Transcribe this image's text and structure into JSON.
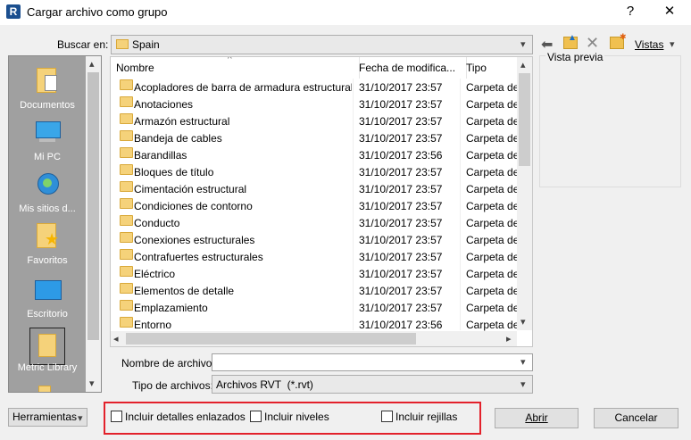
{
  "window": {
    "title": "Cargar archivo como grupo",
    "help_label": "?",
    "close_label": "✕",
    "app_icon_letter": "R"
  },
  "lookin": {
    "label": "Buscar en:",
    "value": "Spain"
  },
  "toolbar": {
    "views_label": "Vistas"
  },
  "places": [
    {
      "label": "Documentos"
    },
    {
      "label": "Mi PC"
    },
    {
      "label": "Mis sitios d..."
    },
    {
      "label": "Favoritos"
    },
    {
      "label": "Escritorio"
    },
    {
      "label": "Metric Library"
    }
  ],
  "columns": {
    "name": "Nombre",
    "date": "Fecha de modifica...",
    "type": "Tipo"
  },
  "files": [
    {
      "name": "Acopladores de barra de armadura estructural",
      "date": "31/10/2017 23:57",
      "type": "Carpeta de"
    },
    {
      "name": "Anotaciones",
      "date": "31/10/2017 23:57",
      "type": "Carpeta de"
    },
    {
      "name": "Armazón estructural",
      "date": "31/10/2017 23:57",
      "type": "Carpeta de"
    },
    {
      "name": "Bandeja de cables",
      "date": "31/10/2017 23:57",
      "type": "Carpeta de"
    },
    {
      "name": "Barandillas",
      "date": "31/10/2017 23:56",
      "type": "Carpeta de"
    },
    {
      "name": "Bloques de título",
      "date": "31/10/2017 23:57",
      "type": "Carpeta de"
    },
    {
      "name": "Cimentación estructural",
      "date": "31/10/2017 23:57",
      "type": "Carpeta de"
    },
    {
      "name": "Condiciones de contorno",
      "date": "31/10/2017 23:57",
      "type": "Carpeta de"
    },
    {
      "name": "Conducto",
      "date": "31/10/2017 23:57",
      "type": "Carpeta de"
    },
    {
      "name": "Conexiones estructurales",
      "date": "31/10/2017 23:57",
      "type": "Carpeta de"
    },
    {
      "name": "Contrafuertes estructurales",
      "date": "31/10/2017 23:57",
      "type": "Carpeta de"
    },
    {
      "name": "Eléctrico",
      "date": "31/10/2017 23:57",
      "type": "Carpeta de"
    },
    {
      "name": "Elementos de detalle",
      "date": "31/10/2017 23:57",
      "type": "Carpeta de"
    },
    {
      "name": "Emplazamiento",
      "date": "31/10/2017 23:57",
      "type": "Carpeta de"
    },
    {
      "name": "Entorno",
      "date": "31/10/2017 23:56",
      "type": "Carpeta de"
    }
  ],
  "preview": {
    "label": "Vista previa"
  },
  "filename": {
    "label": "Nombre de archivo:",
    "value": ""
  },
  "filetype": {
    "label": "Tipo de archivos:",
    "value": "Archivos RVT  (*.rvt)"
  },
  "options": {
    "detalles": "Incluir detalles enlazados",
    "niveles": "Incluir niveles",
    "rejillas": "Incluir rejillas"
  },
  "buttons": {
    "tools": "Herramientas",
    "open": "Abrir",
    "cancel": "Cancelar"
  },
  "colors": {
    "highlight": "#e3212b",
    "sidebar": "#a0a0a0"
  }
}
